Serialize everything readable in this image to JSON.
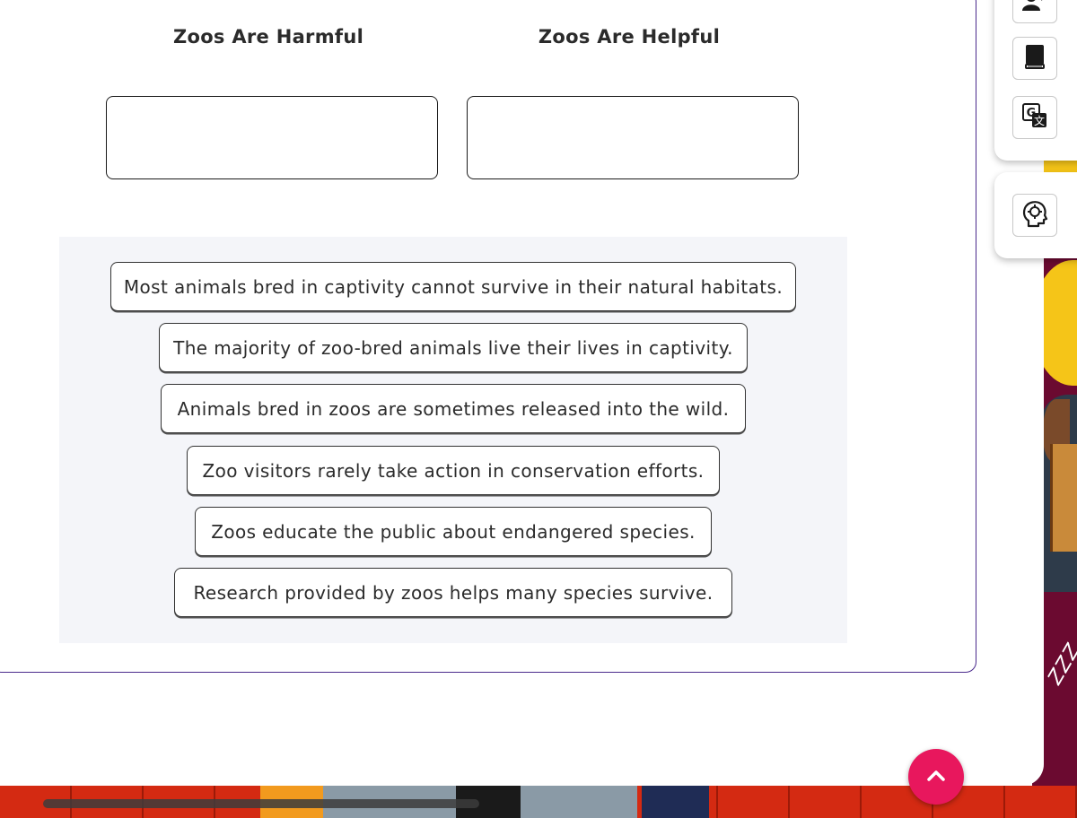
{
  "categories": {
    "left_heading": "Zoos Are Harmful",
    "right_heading": "Zoos Are Helpful"
  },
  "statements": [
    "Most animals bred in captivity cannot survive in their natural habitats.",
    "The majority of zoo-bred animals live their lives in captivity.",
    "Animals bred in zoos are sometimes released into the wild.",
    "Zoo visitors rarely take action in conservation efforts.",
    "Zoos educate the public about endangered species.",
    "Research provided by zoos helps many species survive."
  ],
  "toolbar": {
    "icons": [
      "read-aloud-icon",
      "book-icon",
      "translate-icon",
      "mind-help-icon"
    ]
  },
  "background": {
    "decor_text": "ZZZ"
  },
  "colors": {
    "accent": "#e8175d",
    "card_border": "#4a2a8c",
    "bank_bg": "#f4f5f9"
  }
}
